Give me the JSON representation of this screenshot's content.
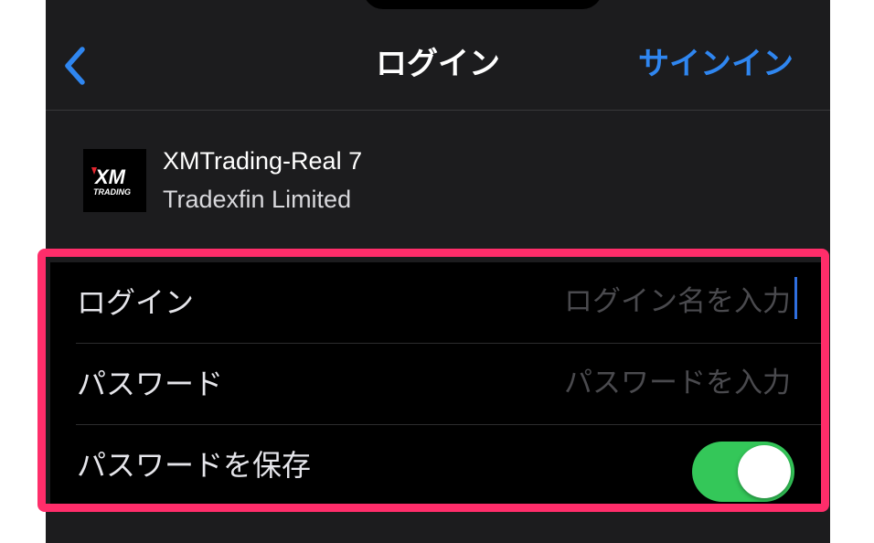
{
  "navbar": {
    "back_icon": "chevron-left-icon",
    "title": "ログイン",
    "action_label": "サインイン",
    "accent_color": "#2f86f0"
  },
  "server": {
    "logo_text": "XM",
    "logo_subtext": "TRADING",
    "name": "XMTrading-Real 7",
    "company": "Tradexfin Limited"
  },
  "form": {
    "login": {
      "label": "ログイン",
      "value": "",
      "placeholder": "ログイン名を入力"
    },
    "password": {
      "label": "パスワード",
      "value": "",
      "placeholder": "パスワードを入力"
    },
    "save_password": {
      "label": "パスワードを保存",
      "enabled": true,
      "on_color": "#34c759"
    }
  },
  "annotation": {
    "highlight_color": "#ff2d6a"
  }
}
